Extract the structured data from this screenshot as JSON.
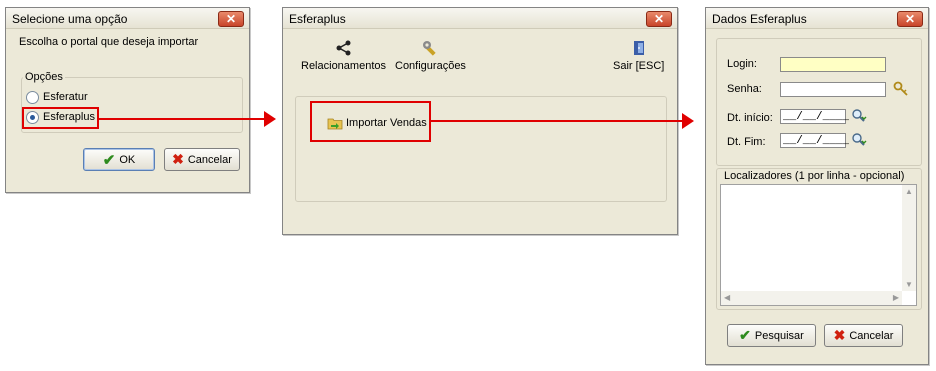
{
  "dialog1": {
    "title": "Selecione uma opção",
    "prompt": "Escolha o portal que deseja importar",
    "group_label": "Opções",
    "options": [
      {
        "label": "Esferatur",
        "selected": false
      },
      {
        "label": "Esferaplus",
        "selected": true
      }
    ],
    "ok_label": "OK",
    "cancel_label": "Cancelar"
  },
  "dialog2": {
    "title": "Esferaplus",
    "toolbar": {
      "relacionamentos": "Relacionamentos",
      "configuracoes": "Configurações",
      "sair": "Sair [ESC]"
    },
    "import_label": "Importar Vendas"
  },
  "dialog3": {
    "title": "Dados Esferaplus",
    "login_label": "Login:",
    "login_value": "",
    "senha_label": "Senha:",
    "dt_inicio_label": "Dt. início:",
    "dt_fim_label": "Dt. Fim:",
    "date_mask": "__/__/____",
    "localizadores_label": "Localizadores (1 por linha - opcional)",
    "search_label": "Pesquisar",
    "cancel_label": "Cancelar"
  },
  "colors": {
    "highlight": "#e00000",
    "window_bg": "#ece9d8",
    "login_bg": "#ffffc4"
  }
}
